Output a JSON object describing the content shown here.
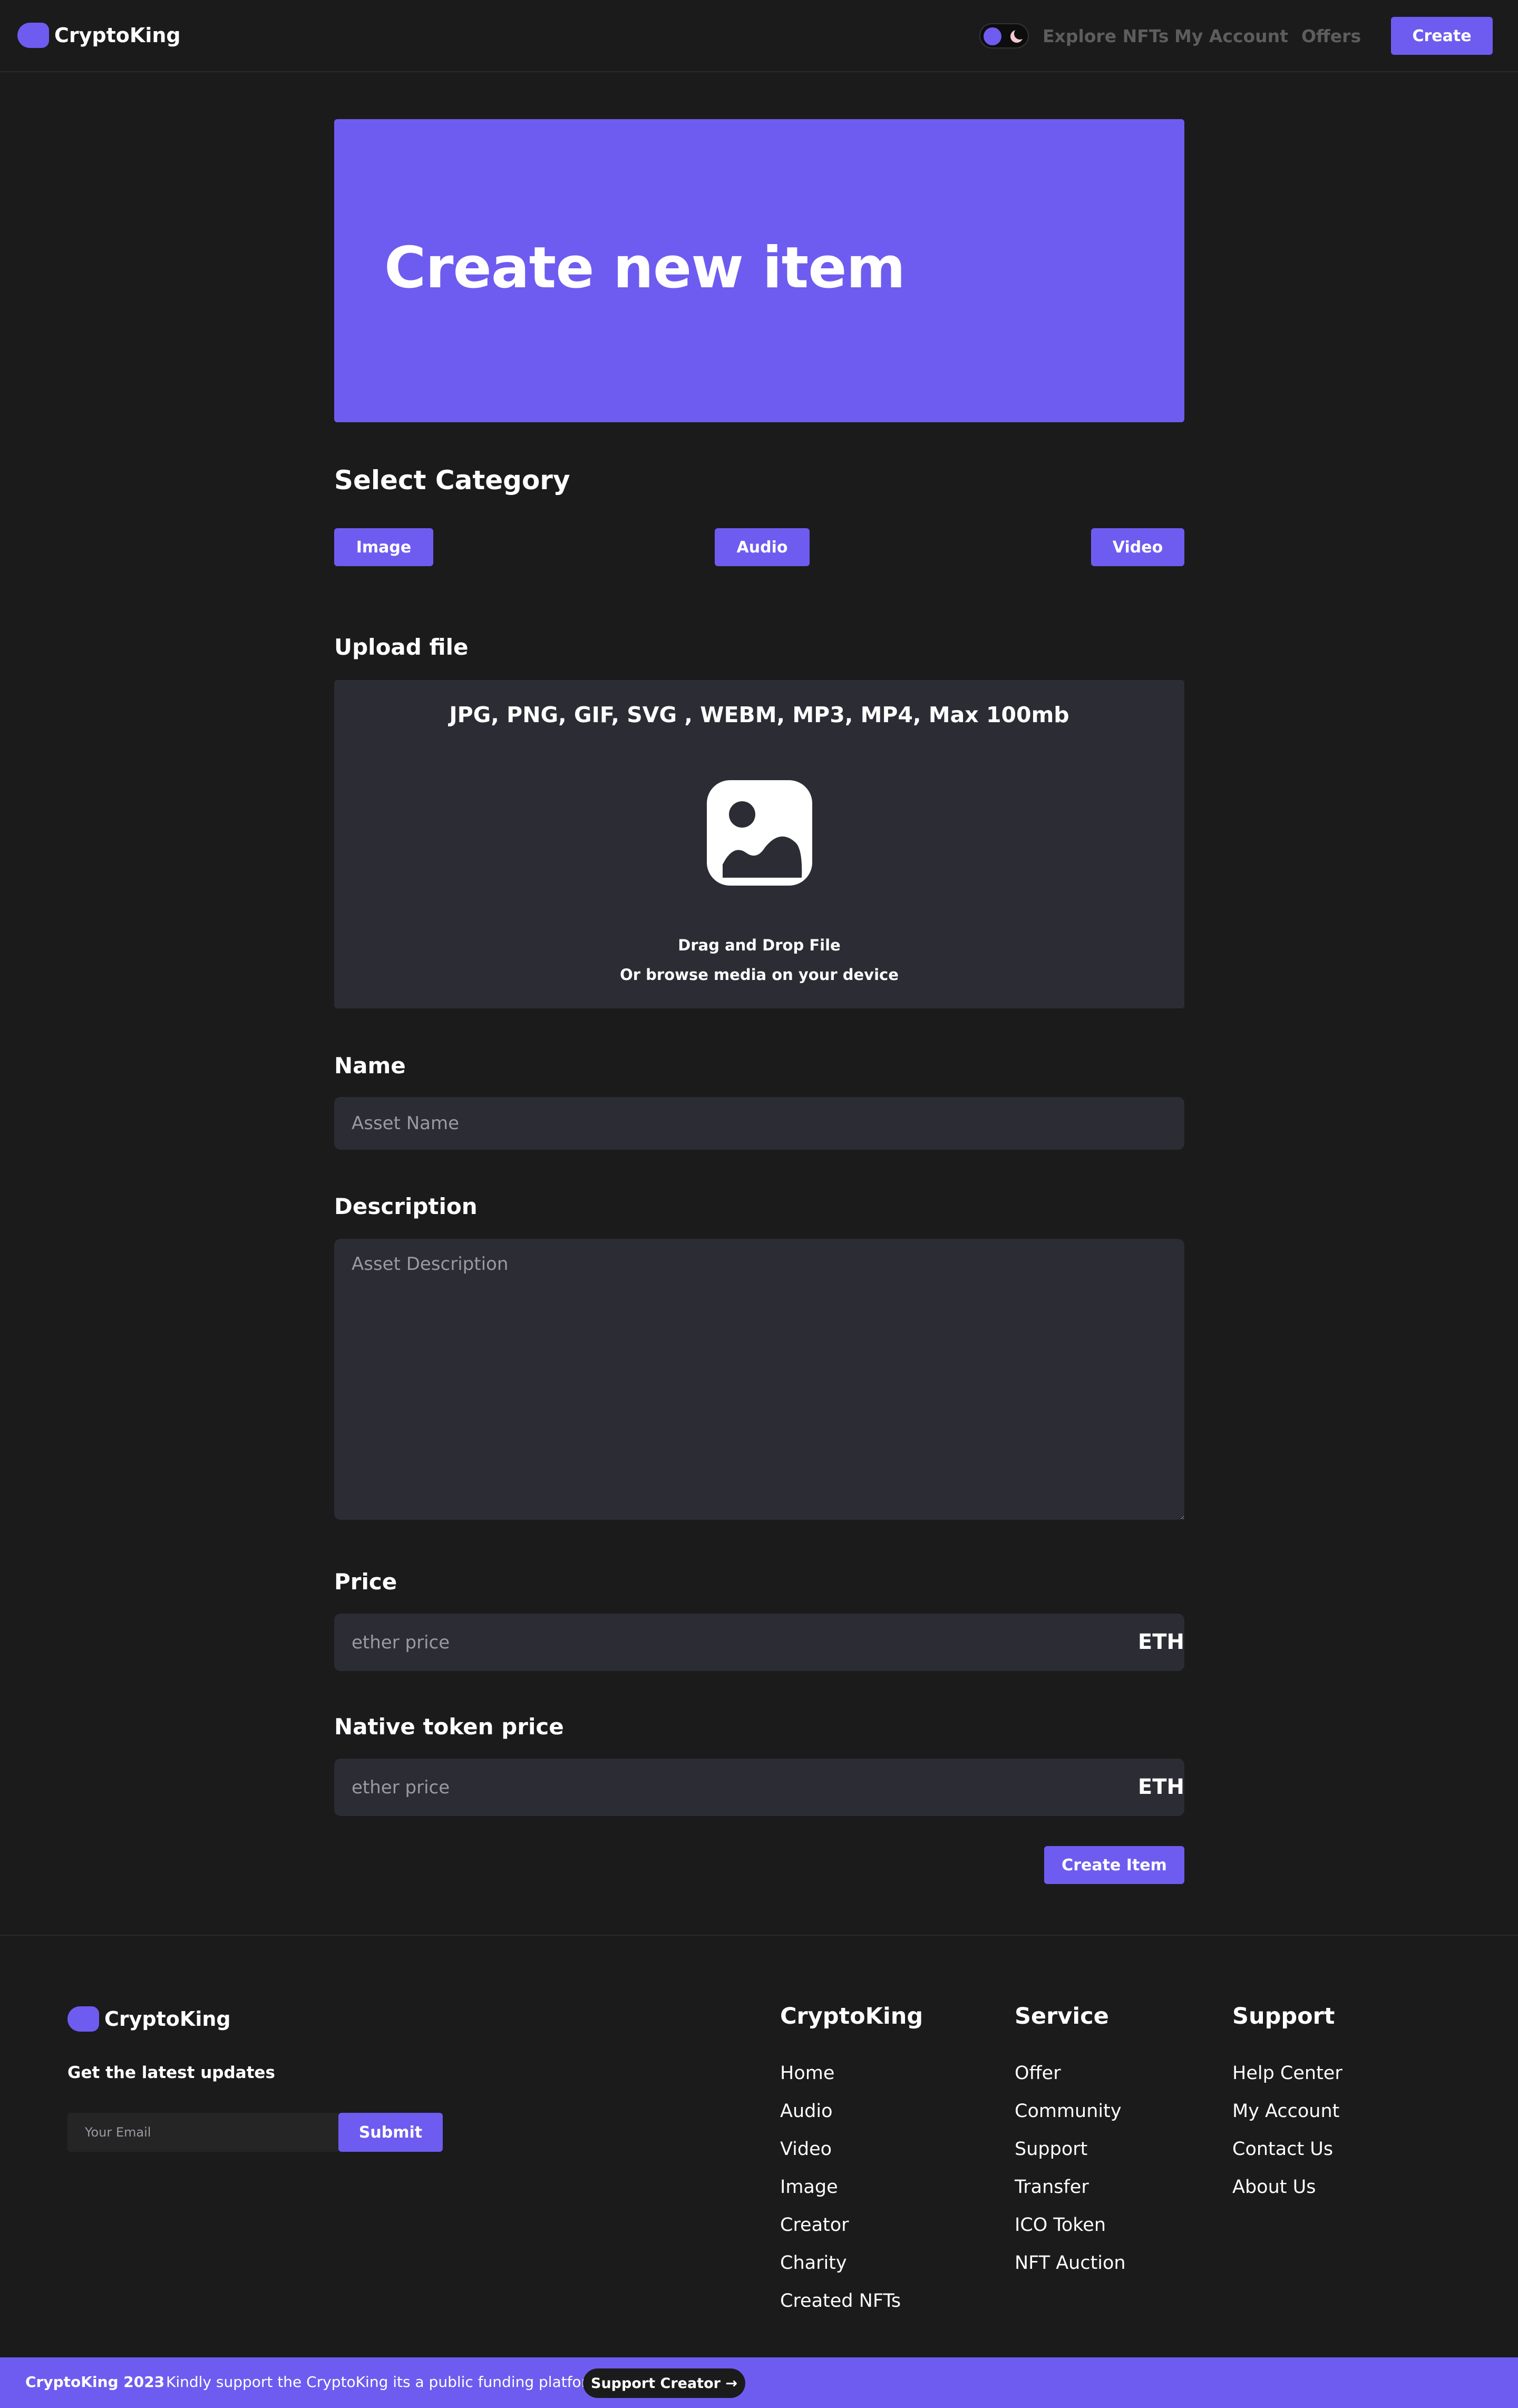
{
  "header": {
    "brand": "CryptoKing",
    "nav": [
      "Explore NFTs",
      "My Account",
      "Offers"
    ],
    "create_label": "Create"
  },
  "hero": {
    "title": "Create new item"
  },
  "category": {
    "title": "Select Category",
    "options": [
      "Image",
      "Audio",
      "Video"
    ]
  },
  "upload": {
    "title": "Upload file",
    "formats": "JPG, PNG, GIF, SVG , WEBM, MP3, MP4, Max 100mb",
    "drag": "Drag and Drop File",
    "browse": "Or browse media on your device"
  },
  "form": {
    "name_label": "Name",
    "name_placeholder": "Asset Name",
    "description_label": "Description",
    "description_placeholder": "Asset Description",
    "price_label": "Price",
    "price_placeholder": "ether price",
    "price_unit": "ETH",
    "native_label": "Native token price",
    "native_placeholder": "ether price",
    "native_unit": "ETH",
    "submit_label": "Create Item"
  },
  "footer": {
    "brand": "CryptoKing",
    "updates": "Get the latest updates",
    "email_placeholder": "Your Email",
    "submit_label": "Submit",
    "columns": [
      {
        "title": "CryptoKing",
        "items": [
          "Home",
          "Audio",
          "Video",
          "Image",
          "Creator",
          "Charity",
          "Created NFTs"
        ]
      },
      {
        "title": "Service",
        "items": [
          "Offer",
          "Community",
          "Support",
          "Transfer",
          "ICO Token",
          "NFT Auction"
        ]
      },
      {
        "title": "Support",
        "items": [
          "Help Center",
          "My Account",
          "Contact Us",
          "About Us"
        ]
      }
    ]
  },
  "bottom_bar": {
    "copyright": "CryptoKing 2023",
    "separator": "·",
    "message": "Kindly support the CryptoKing its a public funding platform",
    "button": "Support Creator →"
  },
  "colors": {
    "accent": "#6e5cf0",
    "background": "#1b1b1b",
    "field": "#2c2c34"
  }
}
